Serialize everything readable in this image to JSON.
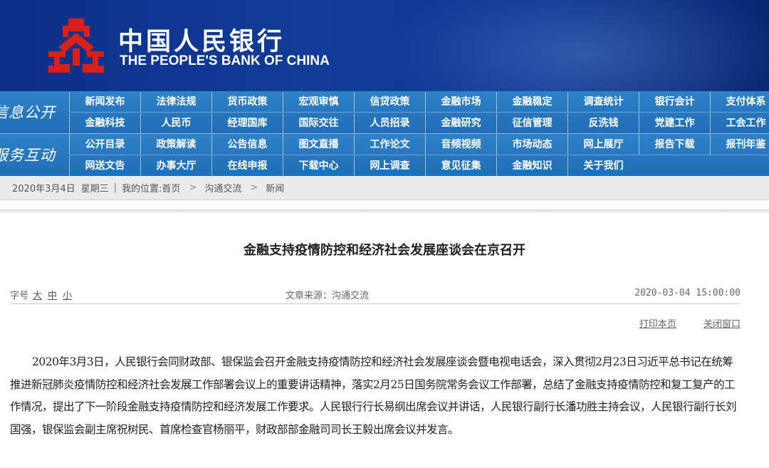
{
  "header": {
    "cn_name": "中国人民银行",
    "en_name": "THE PEOPLE'S BANK OF CHINA",
    "logo_icon": "pboc-emblem-icon",
    "colors": {
      "banner": "#123c98",
      "emblem": "#d7201a",
      "nav": "#2575bd"
    }
  },
  "nav": {
    "section1": "信息公开",
    "section2": "服务互动",
    "rows": [
      [
        "新闻发布",
        "法律法规",
        "货币政策",
        "宏观审慎",
        "信贷政策",
        "金融市场",
        "金融稳定",
        "调查统计",
        "银行会计",
        "支付体系"
      ],
      [
        "金融科技",
        "人民币",
        "经理国库",
        "国际交往",
        "人员招录",
        "金融研究",
        "征信管理",
        "反洗钱",
        "党建工作",
        "工会工作"
      ],
      [
        "公开目录",
        "政策解读",
        "公告信息",
        "图文直播",
        "工作论文",
        "音频视频",
        "市场动态",
        "网上展厅",
        "报告下载",
        "报刊年鉴"
      ],
      [
        "网送文告",
        "办事大厅",
        "在线申报",
        "下载中心",
        "网上调查",
        "意见征集",
        "金融知识",
        "关于我们"
      ]
    ]
  },
  "breadcrumb": {
    "date": "2020年3月4日",
    "weekday": "星期三",
    "separator": "|",
    "location_label": "我的位置:首页",
    "arrow": ">",
    "level1": "沟通交流",
    "level2": "新闻"
  },
  "article": {
    "title": "金融支持疫情防控和经济社会发展座谈会在京召开",
    "font_size_label": "字号",
    "size_large": "大",
    "size_medium": "中",
    "size_small": "小",
    "source": "文章来源：沟通交流",
    "datetime": "2020-03-04 15:00:00",
    "print_label": "打印本页",
    "close_label": "关闭窗口",
    "paragraph": "2020年3月3日，人民银行会同财政部、银保监会召开金融支持疫情防控和经济社会发展座谈会暨电视电话会，深入贯彻2月23日习近平总书记在统筹推进新冠肺炎疫情防控和经济社会发展工作部署会议上的重要讲话精神，落实2月25日国务院常务会议工作部署，总结了金融支持疫情防控和复工复产的工作情况，提出了下一阶段金融支持疫情防控和经济发展工作要求。人民银行行长易纲出席会议并讲话，人民银行副行长潘功胜主持会议，人民银行副行长刘国强，银保监会副主席祝树民、首席检查官杨丽平，财政部部金融司司长王毅出席会议并发言。"
  }
}
